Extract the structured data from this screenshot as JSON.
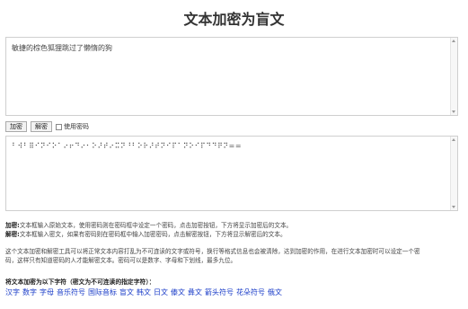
{
  "page_title": "文本加密为盲文",
  "input": {
    "value": "敏捷的棕色狐狸跳过了懒惰的狗"
  },
  "controls": {
    "encrypt_label": "加密",
    "decrypt_label": "解密",
    "use_password_label": "使用密码",
    "use_password_checked": false
  },
  "output": {
    "value": "⠃⠺⠃⠿⠊⠝⠊⠕⠁⠔⠖⠙⠔⠂⠕⠜⠞⠔⠭⠝⠘⠃⠕⠗⠜⠞⠝⠊⠏⠁⠝⠕⠊⠏⠙⠙⠟⠝=="
  },
  "help": {
    "encrypt_term": "加密:",
    "encrypt_text": "文本框输入原始文本，使用密码则在密码框中设定一个密码，点击加密按钮，下方将显示加密后的文本。",
    "decrypt_term": "解密:",
    "decrypt_text": "文本框输入密文，如果有密码则在密码框中输入加密密码，点击解密按钮，下方将显示解密后的文本。",
    "desc1": "这个文本加密和解密工具可以将正常文本内容打乱为不可连读的文字或符号，换行等格式信息也会被清除，达到加密的作用，在进行文本加密时可以设定一个密",
    "desc2": "码，这样只有知道密码的人才能解密文本。密码可以是数字、字母和下划线，最多九位。"
  },
  "section_title": "将文本加密为以下字符（密文为不可连读的指定字符）：",
  "links": [
    "汉字",
    "数字",
    "字母",
    "音乐符号",
    "国际音标",
    "盲文",
    "韩文",
    "日文",
    "傣文",
    "彝文",
    "箭头符号",
    "花朵符号",
    "俄文"
  ]
}
